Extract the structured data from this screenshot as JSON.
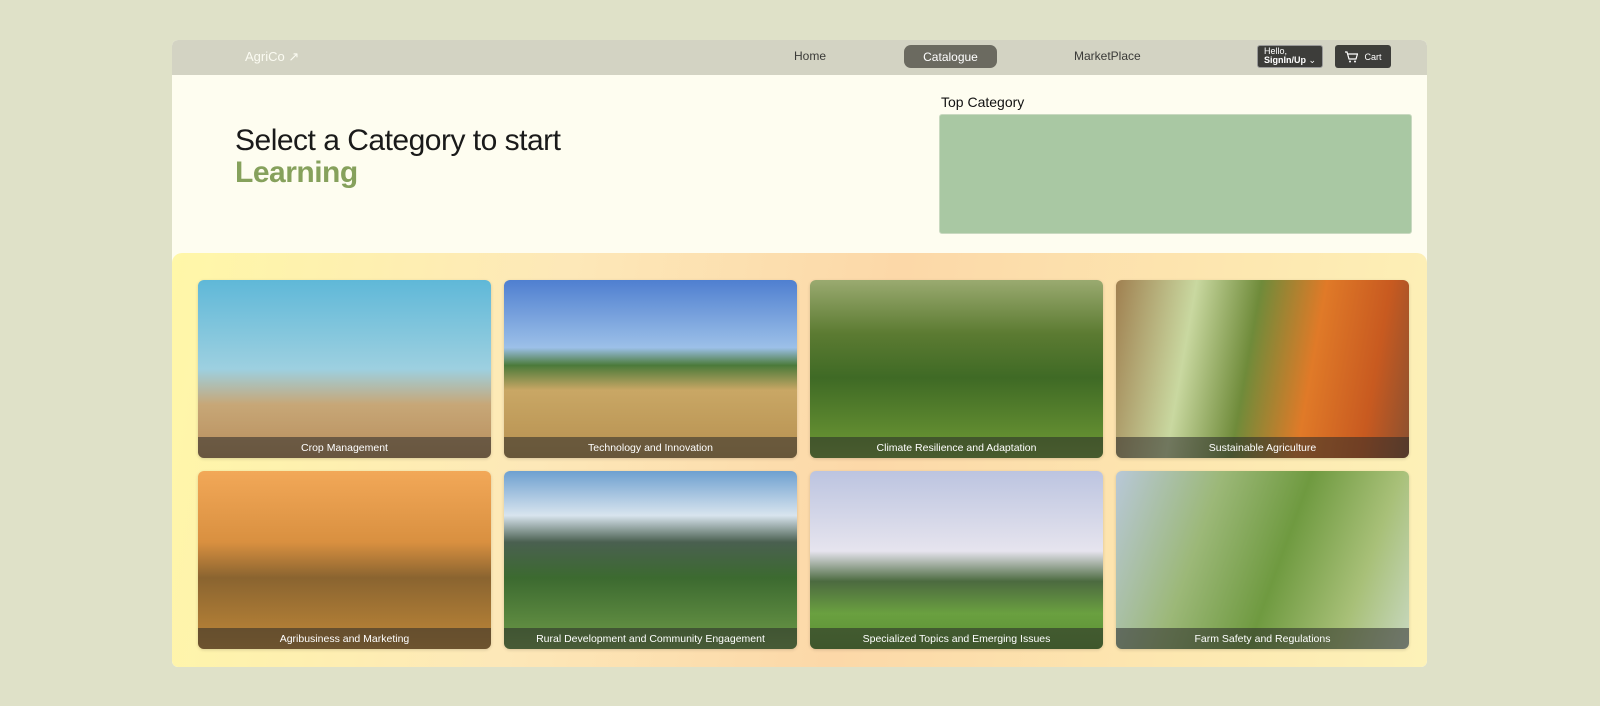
{
  "navbar": {
    "logo": "AgriCo ↗",
    "links": {
      "home": "Home",
      "catalogue": "Catalogue",
      "marketplace": "MarketPlace"
    },
    "signin_hello": "Hello,",
    "signin_action": "SignIn/Up",
    "cart_label": "Cart"
  },
  "hero": {
    "line1": "Select a Category to start",
    "line2": "Learning"
  },
  "top_category": {
    "title": "Top Category"
  },
  "categories": [
    {
      "label": "Crop Management"
    },
    {
      "label": "Technology and Innovation"
    },
    {
      "label": "Climate Resilience and Adaptation"
    },
    {
      "label": "Sustainable Agriculture"
    },
    {
      "label": "Agribusiness and Marketing"
    },
    {
      "label": "Rural Development and Community Engagement"
    },
    {
      "label": "Specialized Topics and Emerging Issues"
    },
    {
      "label": "Farm Safety and Regulations"
    }
  ],
  "colors": {
    "page_bg": "#dfe1c8",
    "accent_green": "#86a15c",
    "top_category_box": "#a9c8a3",
    "nav_active": "#6b6a60"
  }
}
